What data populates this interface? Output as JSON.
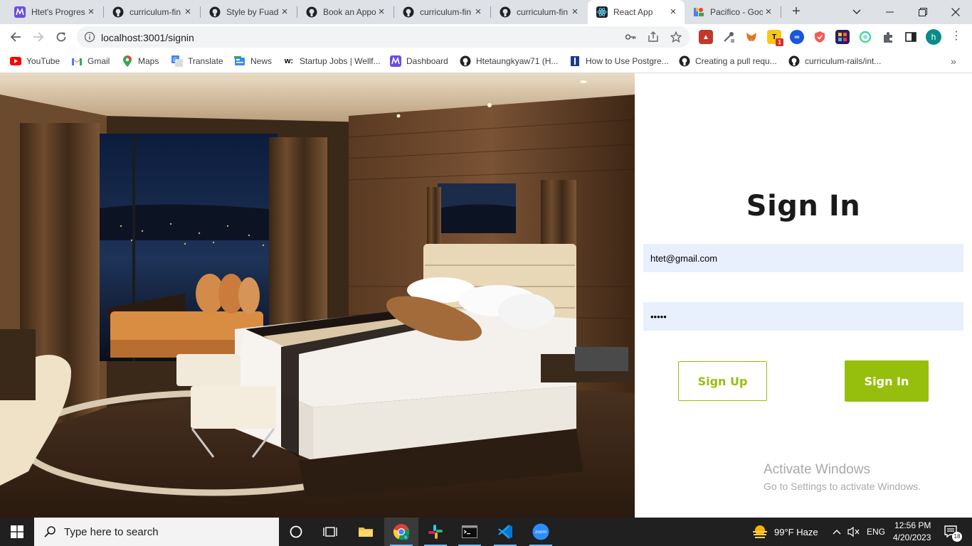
{
  "browser": {
    "tabs": [
      {
        "title": "Htet's Progres",
        "icon": "progress-app-icon"
      },
      {
        "title": "curriculum-fin",
        "icon": "github-icon"
      },
      {
        "title": "Style by Fuad",
        "icon": "github-icon"
      },
      {
        "title": "Book an Appo",
        "icon": "github-icon"
      },
      {
        "title": "curriculum-fin",
        "icon": "github-icon"
      },
      {
        "title": "curriculum-fin",
        "icon": "github-icon"
      },
      {
        "title": "React App",
        "icon": "react-icon",
        "active": true
      },
      {
        "title": "Pacifico - Goo",
        "icon": "google-fonts-icon"
      }
    ],
    "url": "localhost:3001/signin",
    "profile_initial": "h",
    "extension_badge": "1",
    "bookmarks": [
      {
        "label": "YouTube",
        "icon": "youtube-icon"
      },
      {
        "label": "Gmail",
        "icon": "gmail-icon"
      },
      {
        "label": "Maps",
        "icon": "maps-icon"
      },
      {
        "label": "Translate",
        "icon": "translate-icon"
      },
      {
        "label": "News",
        "icon": "news-icon"
      },
      {
        "label": "Startup Jobs | Wellf...",
        "icon": "wellfound-icon"
      },
      {
        "label": "Dashboard",
        "icon": "progress-app-icon"
      },
      {
        "label": "Htetaungkyaw71 (H...",
        "icon": "github-icon"
      },
      {
        "label": "How to Use Postgre...",
        "icon": "bookmark-blue-icon"
      },
      {
        "label": "Creating a pull requ...",
        "icon": "github-icon"
      },
      {
        "label": "curriculum-rails/int...",
        "icon": "github-icon"
      }
    ]
  },
  "signin": {
    "heading": "Sign In",
    "email_value": "htet@gmail.com",
    "password_value": "•••••",
    "signup_label": "Sign Up",
    "signin_label": "Sign In",
    "accent_color": "#96bf0d"
  },
  "watermark": {
    "title": "Activate Windows",
    "subtitle": "Go to Settings to activate Windows."
  },
  "taskbar": {
    "search_placeholder": "Type here to search",
    "weather": "99°F  Haze",
    "language": "ENG",
    "time": "12:56 PM",
    "date": "4/20/2023",
    "notification_count": "18"
  }
}
